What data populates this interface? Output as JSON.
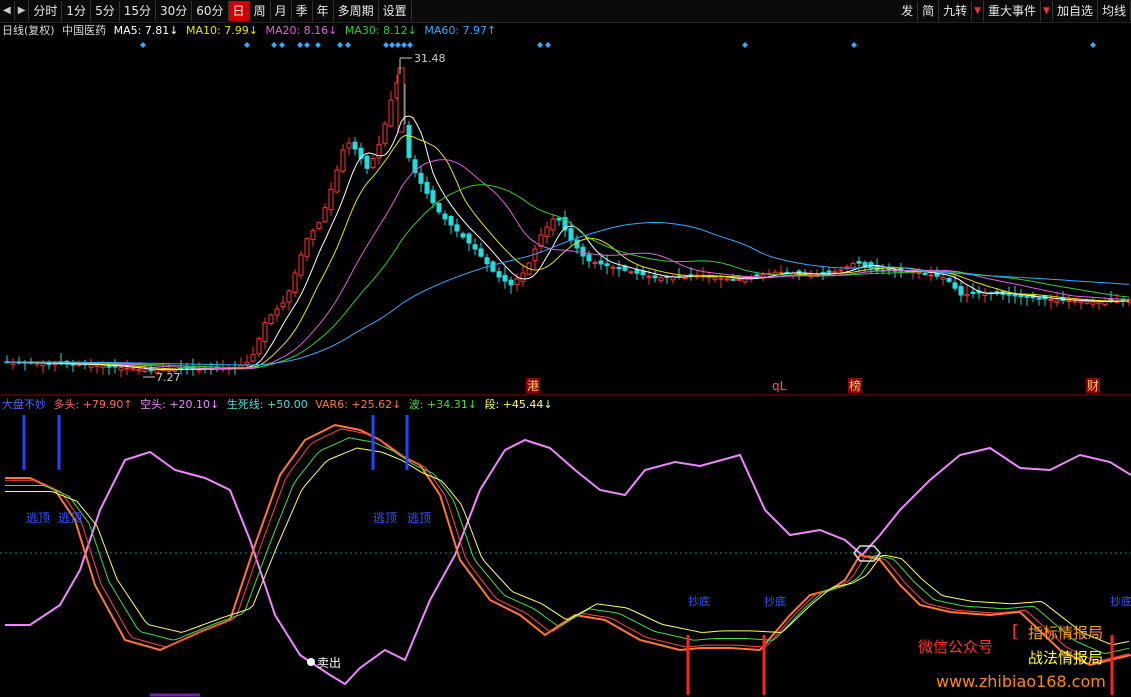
{
  "toolbar": {
    "nav_back": "◀",
    "nav_fwd": "▶",
    "periods": [
      "分时",
      "1分",
      "5分",
      "15分",
      "30分",
      "60分",
      "日",
      "周",
      "月",
      "季",
      "年",
      "多周期",
      "设置"
    ],
    "active_period": "日",
    "right_buttons": [
      "发",
      "简",
      "九转",
      "重大事件",
      "加自选",
      "均线"
    ]
  },
  "main_legend": {
    "period": "日线(复权)",
    "stock": "中国医药",
    "ma": [
      {
        "label": "MA5: 7.81↓",
        "color": "#ffffff"
      },
      {
        "label": "MA10: 7.99↓",
        "color": "#e6e600"
      },
      {
        "label": "MA20: 8.16↓",
        "color": "#e060e0"
      },
      {
        "label": "MA30: 8.12↓",
        "color": "#33cc33"
      },
      {
        "label": "MA60: 7.97↑",
        "color": "#33aaff"
      }
    ]
  },
  "sub_legend": [
    {
      "label": "大盘不妙",
      "color": "#4466ff"
    },
    {
      "label": "多头: +79.90↑",
      "color": "#ff6666"
    },
    {
      "label": "空头: +20.10↓",
      "color": "#ee88ff"
    },
    {
      "label": "生死线: +50.00",
      "color": "#44dddd"
    },
    {
      "label": "VAR6: +25.62↓",
      "color": "#ff7733"
    },
    {
      "label": "波: +34.31↓",
      "color": "#44dd44"
    },
    {
      "label": "段: +45.44↓",
      "color": "#ffff66"
    }
  ],
  "chart_data": {
    "type": "candlestick",
    "price_high_label": "31.48",
    "price_low_label": "7.27",
    "event_tags": [
      "港",
      "qL",
      "榜",
      "财"
    ],
    "sub_annotations": {
      "escape": "逃顶",
      "bottom": "抄底",
      "sell": "卖出"
    },
    "colors": {
      "up": "#ff3333",
      "down": "#22dddd",
      "ma5": "#ffffff",
      "ma10": "#e6e600",
      "ma20": "#e060e0",
      "ma30": "#33cc33",
      "ma60": "#33aaff"
    }
  },
  "watermark": {
    "wechat": "微信公众号",
    "line1": "指标情报局",
    "line2": "战法情报局",
    "url": "www.zhibiao168.com"
  }
}
